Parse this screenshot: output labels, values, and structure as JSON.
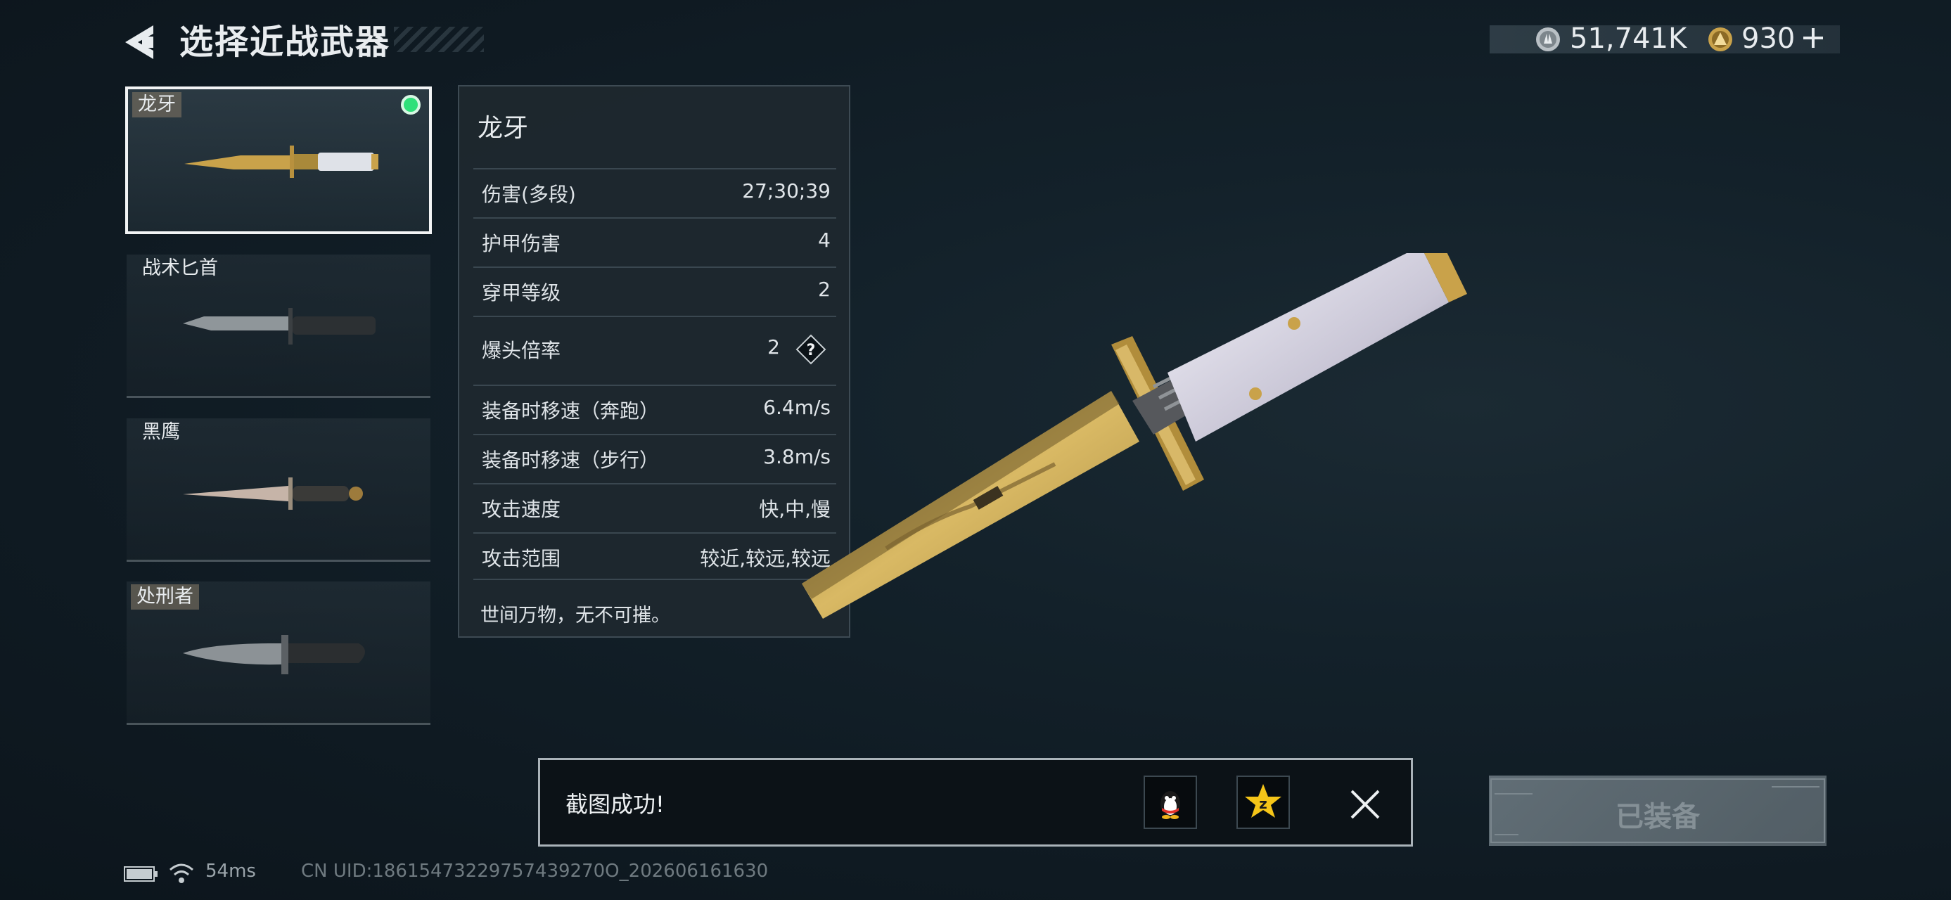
{
  "header": {
    "title": "选择近战武器",
    "silver_amount": "51,741K",
    "gold_amount": "930"
  },
  "weapons": [
    {
      "name": "龙牙",
      "tagged": true,
      "selected": true,
      "equipped": true
    },
    {
      "name": "战术匕首",
      "tagged": false,
      "selected": false,
      "equipped": false
    },
    {
      "name": "黑鹰",
      "tagged": false,
      "selected": false,
      "equipped": false
    },
    {
      "name": "处刑者",
      "tagged": true,
      "selected": false,
      "equipped": false
    }
  ],
  "stats": {
    "title": "龙牙",
    "rows": [
      {
        "label": "伤害(多段)",
        "value": "27;30;39"
      },
      {
        "label": "护甲伤害",
        "value": "4"
      },
      {
        "label": "穿甲等级",
        "value": "2"
      },
      {
        "label": "爆头倍率",
        "value": "2"
      },
      {
        "label": "装备时移速（奔跑）",
        "value": "6.4m/s"
      },
      {
        "label": "装备时移速（步行）",
        "value": "3.8m/s"
      },
      {
        "label": "攻击速度",
        "value": "快,中,慢"
      },
      {
        "label": "攻击范围",
        "value": "较近,较远,较远"
      }
    ],
    "description": "世间万物，无不可摧。"
  },
  "toast": {
    "message": "截图成功!"
  },
  "equip_button": {
    "label": "已装备"
  },
  "status_bar": {
    "ping": "54ms",
    "uid": "CN UID:18615473229757439270O_202606161630"
  },
  "colors": {
    "background": "#13212a",
    "equipped_dot": "#2fe07a",
    "gold": "#c9a24a",
    "panel": "#1e282f"
  }
}
